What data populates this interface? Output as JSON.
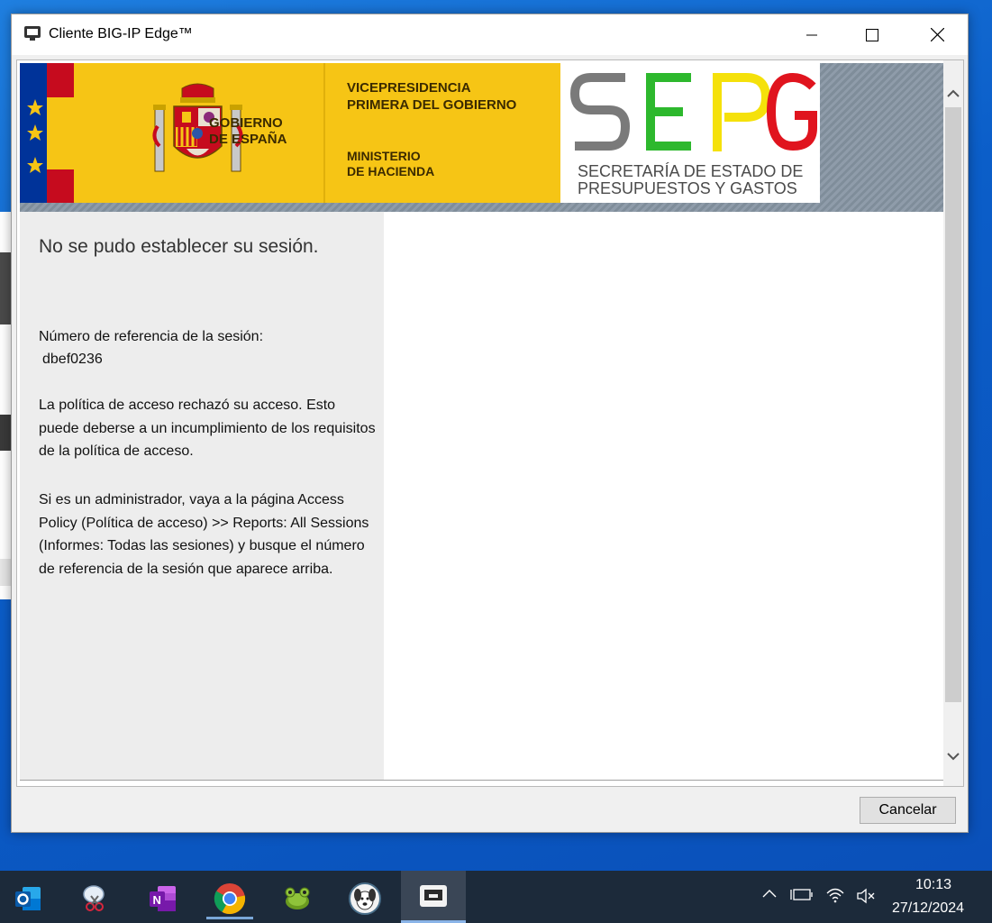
{
  "window": {
    "title": "Cliente BIG-IP Edge™"
  },
  "banner": {
    "gobierno": "GOBIERNO\nDE ESPAÑA",
    "vicepresidencia": "VICEPRESIDENCIA\nPRIMERA DEL GOBIERNO",
    "ministerio": "MINISTERIO\nDE HACIENDA",
    "sepg_letters": [
      "S",
      "E",
      "P",
      "G"
    ],
    "sepg_subtitle": "SECRETARÍA DE ESTADO DE\nPRESUPUESTOS Y GASTOS",
    "colors": {
      "yellow": "#f6c515",
      "red": "#c60b1e",
      "eu_blue": "#003399",
      "green": "#2db82d",
      "sepg_yellow": "#f5e10a",
      "sepg_red": "#e0141e"
    }
  },
  "message": {
    "title": "No se pudo establecer su sesión.",
    "ref_label": "Número de referencia de la sesión:",
    "ref_number": "dbef0236",
    "policy_text": "La política de acceso rechazó su acceso. Esto puede deberse a un incumplimiento de los requisitos de la política de acceso.",
    "admin_text": "Si es un administrador, vaya a la página Access Policy (Política de acceso) >> Reports: All Sessions (Informes: Todas las sesiones) y busque el número de referencia de la sesión que aparece arriba."
  },
  "buttons": {
    "cancel": "Cancelar"
  },
  "taskbar": {
    "apps": [
      "outlook-icon",
      "snipping-tool-icon",
      "onenote-icon",
      "chrome-icon",
      "turtle-app-icon",
      "dog-app-icon",
      "big-ip-edge-icon"
    ],
    "time": "10:13",
    "date": "27/12/2024"
  }
}
